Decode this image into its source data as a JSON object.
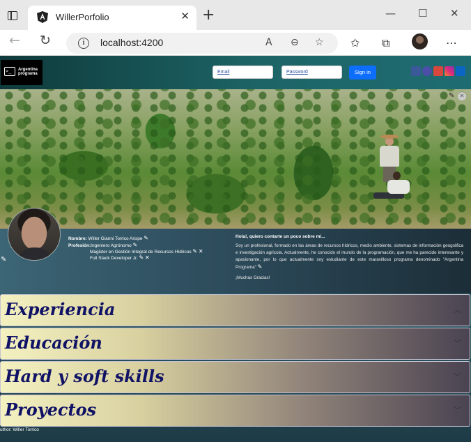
{
  "browser": {
    "tab_title": "WillerPorfolio",
    "url": "localhost:4200"
  },
  "navbar": {
    "logo_text": "Argentina programa",
    "email_placeholder": "Email",
    "password_placeholder": "Password",
    "signin_label": "Sign in",
    "social": [
      {
        "name": "facebook",
        "color": "#3b5998"
      },
      {
        "name": "github",
        "color": "#4b4fa8"
      },
      {
        "name": "gmail",
        "color": "#d8473b"
      },
      {
        "name": "instagram",
        "color": "#c13584"
      },
      {
        "name": "linkedin",
        "color": "#0a66c2"
      }
    ]
  },
  "profile": {
    "name_label": "Nombre:",
    "name": "Willer Gianni Torrico Arispe",
    "profession_label": "Profesión:",
    "profession": "Ingeniero Agrónomo",
    "degrees": [
      "Magister en Gestión Integral de Recursos Hídricos",
      "Full Stack Developer Jr."
    ],
    "about_title": "Hola!, quiero contarte un poco sobre mi...",
    "about_text": "Soy un profesional, formado en las áreas de recursos hídricos, medio ambiente, sistemas de información geográfica e investigación agrícola. Actualmente, he conocido el mundo de la programación, que me ha parecido interesante y apasionante, por lo que actualmente soy estudiante de este maravilloso programa denominado \"Argentina Programa\"",
    "thanks": "¡Muchas Gracias!"
  },
  "sections": [
    {
      "title": "Experiencia",
      "expanded": true
    },
    {
      "title": "Educación",
      "expanded": false
    },
    {
      "title": "Hard y soft skills",
      "expanded": false
    },
    {
      "title": "Proyectos",
      "expanded": false
    }
  ],
  "footer": {
    "text": "uthor: Willer Torrico"
  }
}
